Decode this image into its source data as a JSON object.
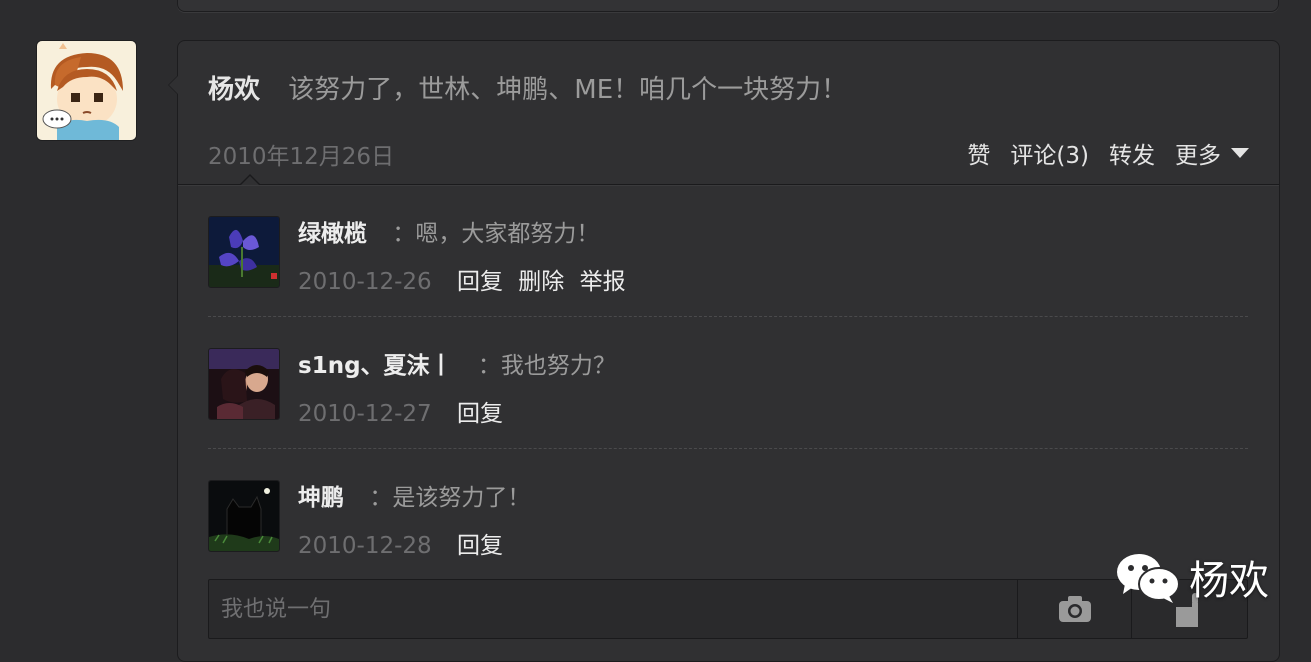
{
  "post": {
    "author": "杨欢",
    "text": "该努力了，世林、坤鹏、ME！咱几个一块努力！",
    "date": "2010年12月26日",
    "actions": {
      "like": "赞",
      "comment": "评论(3)",
      "repost": "转发",
      "more": "更多"
    }
  },
  "comments": [
    {
      "name": "绿橄榄",
      "text": "：嗯，大家都努力！",
      "date": "2010-12-26",
      "actions": [
        "回复",
        "删除",
        "举报"
      ]
    },
    {
      "name": "s1ng、夏沫丨",
      "text": "：我也努力？",
      "date": "2010-12-27",
      "actions": [
        "回复"
      ]
    },
    {
      "name": "坤鹏",
      "text": "：是该努力了！",
      "date": "2010-12-28",
      "actions": [
        "回复"
      ]
    }
  ],
  "reply": {
    "placeholder": "我也说一句"
  },
  "watermark": {
    "text": "杨欢",
    "icon": "wechat-icon"
  },
  "colors": {
    "background": "#2c2c2e",
    "card": "#303032",
    "muted": "#6e6e70",
    "text": "#e6e6e6"
  }
}
